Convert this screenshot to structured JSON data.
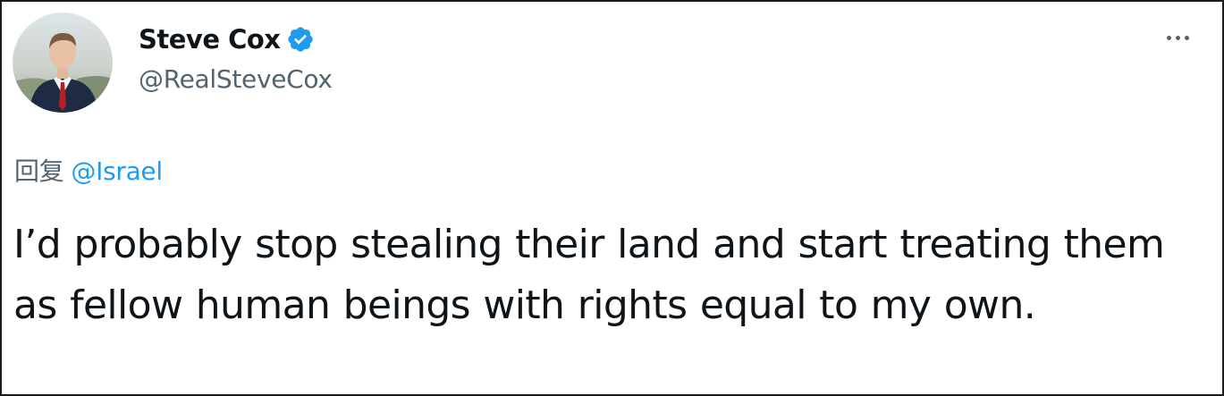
{
  "author": {
    "display_name": "Steve Cox",
    "handle": "@RealSteveCox",
    "verified": true,
    "avatar_icon": "user-avatar-photo",
    "verified_icon": "verified-badge-icon"
  },
  "menu": {
    "icon": "more-options-icon"
  },
  "reply": {
    "prefix": "回复",
    "mention": "@Israel"
  },
  "tweet": {
    "text": "I’d probably stop stealing their land and start treating them as fellow human beings with rights equal to my own."
  },
  "colors": {
    "text_primary": "#0f1419",
    "text_secondary": "#536471",
    "accent": "#1d9bf0",
    "border": "#1a1a1a"
  }
}
